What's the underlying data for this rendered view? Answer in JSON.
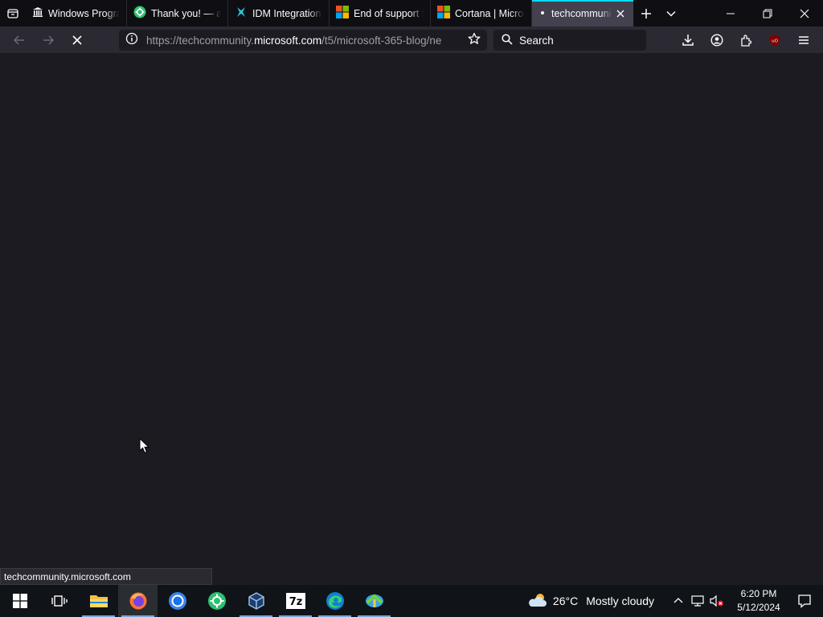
{
  "browser": {
    "tabs": [
      {
        "label": "Windows Program",
        "icon": "institution-icon"
      },
      {
        "label": "Thank you! — auto",
        "icon": "green-gear-icon"
      },
      {
        "label": "IDM Integration",
        "icon": "idm-icon"
      },
      {
        "label": "End of support fo",
        "icon": "microsoft-logo-icon"
      },
      {
        "label": "Cortana | Micros",
        "icon": "microsoft-logo-icon"
      },
      {
        "label": "techcommunity",
        "icon": "loading-dot-icon",
        "active": true
      }
    ],
    "url": {
      "prefix": "https://techcommunity.",
      "domain": "microsoft.com",
      "suffix": "/t5/microsoft-365-blog/ne"
    },
    "search_placeholder": "Search",
    "status_text": "techcommunity.microsoft.com"
  },
  "taskbar": {
    "weather_temp": "26°C",
    "weather_desc": "Mostly cloudy",
    "time": "6:20 PM",
    "date": "5/12/2024"
  },
  "colors": {
    "accent": "#00ddff",
    "content_bg": "#1c1b22",
    "toolbar_bg": "#2b2a33"
  }
}
